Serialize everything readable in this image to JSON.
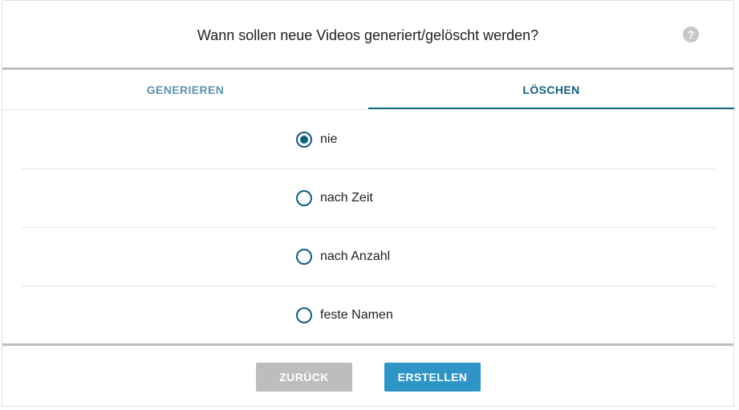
{
  "dialog": {
    "title": "Wann sollen neue Videos generiert/gelöscht werden?",
    "help_icon": "?"
  },
  "tabs": [
    {
      "label": "GENERIEREN",
      "active": false
    },
    {
      "label": "LÖSCHEN",
      "active": true
    }
  ],
  "options": [
    {
      "label": "nie",
      "selected": true
    },
    {
      "label": "nach Zeit",
      "selected": false
    },
    {
      "label": "nach Anzahl",
      "selected": false
    },
    {
      "label": "feste Namen",
      "selected": false
    }
  ],
  "footer": {
    "back_label": "ZURÜCK",
    "create_label": "ERSTELLEN"
  },
  "colors": {
    "accent": "#0f5f7f",
    "primary_button": "#2f95c7",
    "disabled_button": "#bdbdbd"
  }
}
